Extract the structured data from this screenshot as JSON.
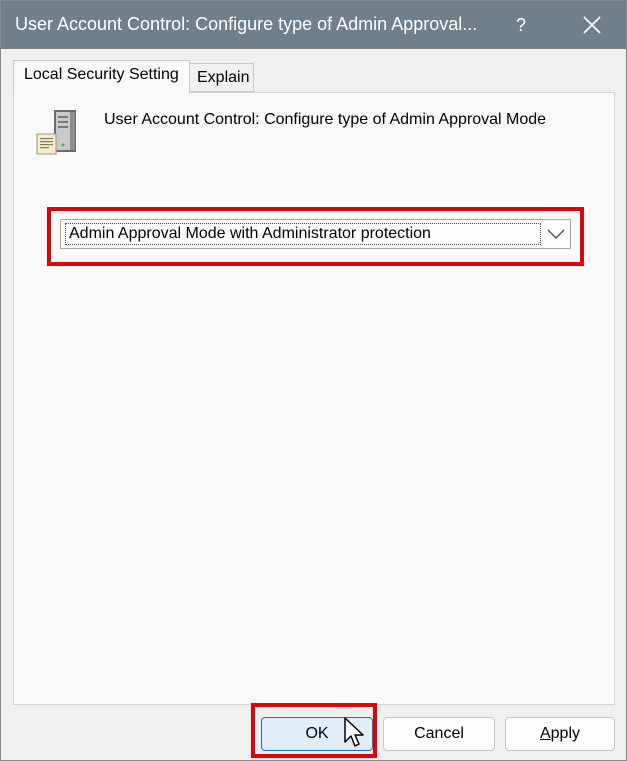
{
  "window": {
    "title": "User Account Control: Configure type of Admin Approval...",
    "help_label": "?"
  },
  "tabs": [
    {
      "label": "Local Security Setting",
      "active": true
    },
    {
      "label": "Explain",
      "active": false
    }
  ],
  "policy": {
    "icon": "server-policy-icon",
    "title": "User Account Control: Configure type of Admin Approval Mode"
  },
  "setting": {
    "selected_value": "Admin Approval Mode with Administrator protection"
  },
  "buttons": {
    "ok_label": "OK",
    "cancel_label": "Cancel",
    "apply_label_first": "A",
    "apply_label_rest": "pply"
  },
  "colors": {
    "titlebar": "#6f7f8c",
    "highlight": "#d9060d",
    "ok_focus_border": "#1c6fc8"
  }
}
